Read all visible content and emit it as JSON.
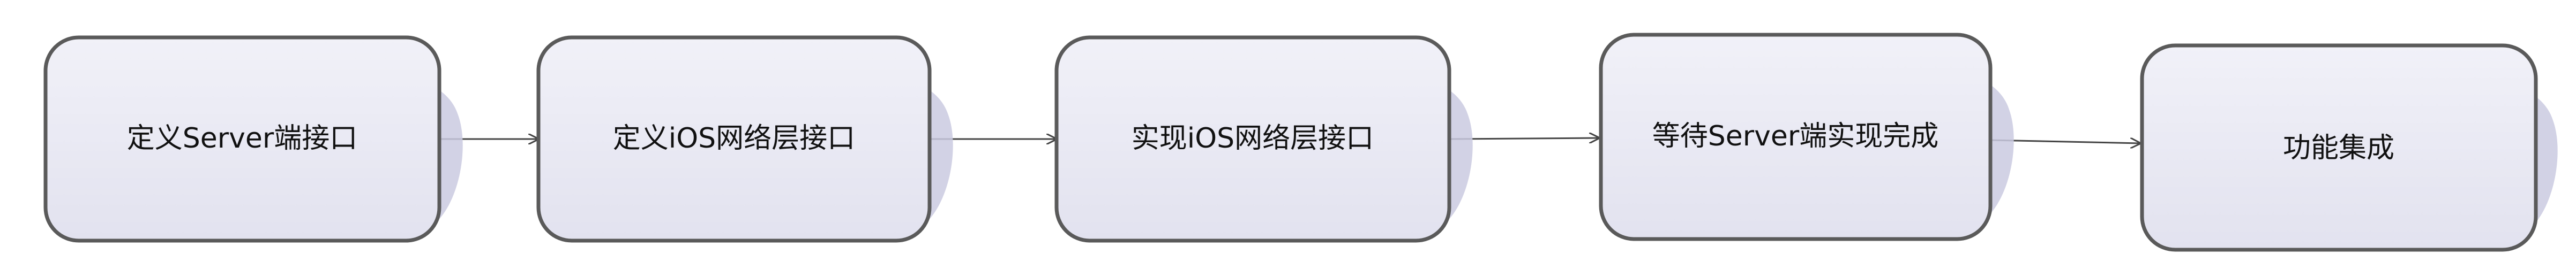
{
  "flow": {
    "steps": [
      {
        "label": "定义Server端接口"
      },
      {
        "label": "定义iOS网络层接口"
      },
      {
        "label": "实现iOS网络层接口"
      },
      {
        "label": "等待Server端实现完成"
      },
      {
        "label": "功能集成"
      }
    ]
  },
  "colors": {
    "node_fill": "#ebebf5",
    "node_border": "#5a5a5a",
    "node_shadow": "#cacae0",
    "connector": "#444444",
    "text": "#111111",
    "background": "#ffffff"
  }
}
